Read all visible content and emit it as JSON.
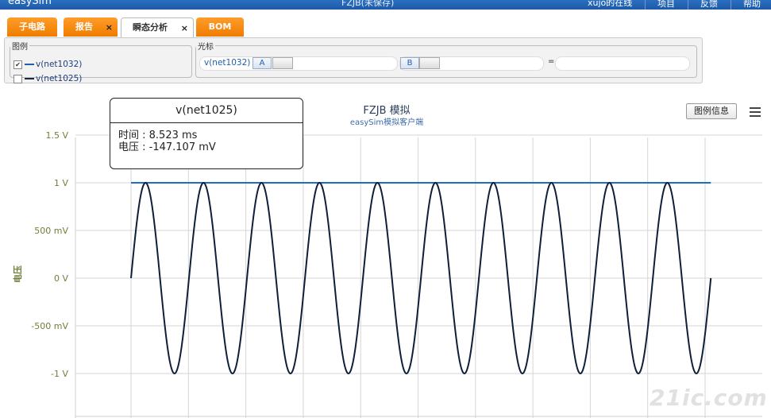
{
  "app": {
    "name": "easySim",
    "project": "FZJB(未保存)",
    "user": "xujo的在线",
    "buttons": [
      "项目",
      "反馈",
      "帮助"
    ]
  },
  "tabs": [
    {
      "label": "子电路",
      "closable": false,
      "active": false
    },
    {
      "label": "报告",
      "closable": true,
      "active": false
    },
    {
      "label": "瞬态分析",
      "closable": true,
      "active": true
    },
    {
      "label": "BOM",
      "closable": false,
      "active": false
    }
  ],
  "close_glyph": "×",
  "legend_panel": {
    "title": "图例",
    "items": [
      {
        "label": "v(net1032)",
        "checked": true,
        "color": "#1f5fae"
      },
      {
        "label": "v(net1025)",
        "checked": false,
        "color": "#1a2740"
      }
    ]
  },
  "cursor_panel": {
    "title": "光标",
    "signal": "v(net1032)",
    "cursor_a": "A",
    "cursor_b": "B",
    "equals": "="
  },
  "chart_toolbar": {
    "legend_info_button": "图例信息",
    "menu_icon": "hamburger-menu-icon"
  },
  "tooltip": {
    "title": "v(net1025)",
    "time": "时间 : 8.523 ms",
    "voltage": "电压 : -147.107 mV"
  },
  "watermark": "21ic.com",
  "chart_data": {
    "type": "line",
    "title": "FZJB 模拟",
    "subtitle": "easySim模拟客户端",
    "xlabel": "",
    "ylabel": "电压",
    "y_ticks": [
      "1.5 V",
      "1 V",
      "500 mV",
      "0 V",
      "-500 mV",
      "-1 V"
    ],
    "y_tick_values": [
      1.5,
      1.0,
      0.5,
      0.0,
      -0.5,
      -1.0
    ],
    "ylim": [
      -1.4,
      1.55
    ],
    "xlim": [
      -1,
      10.4
    ],
    "grid": true,
    "series": [
      {
        "label": "v(net1032)",
        "color": "#1f6fc0",
        "kind": "constant",
        "value": 1.0,
        "x_start": 0,
        "x_end": 10.1
      },
      {
        "label": "v(net1025)",
        "color": "#0f1f3a",
        "kind": "sine",
        "amplitude": 1.0,
        "cycles": 10,
        "x_start": 0,
        "x_end": 10.1
      }
    ]
  }
}
